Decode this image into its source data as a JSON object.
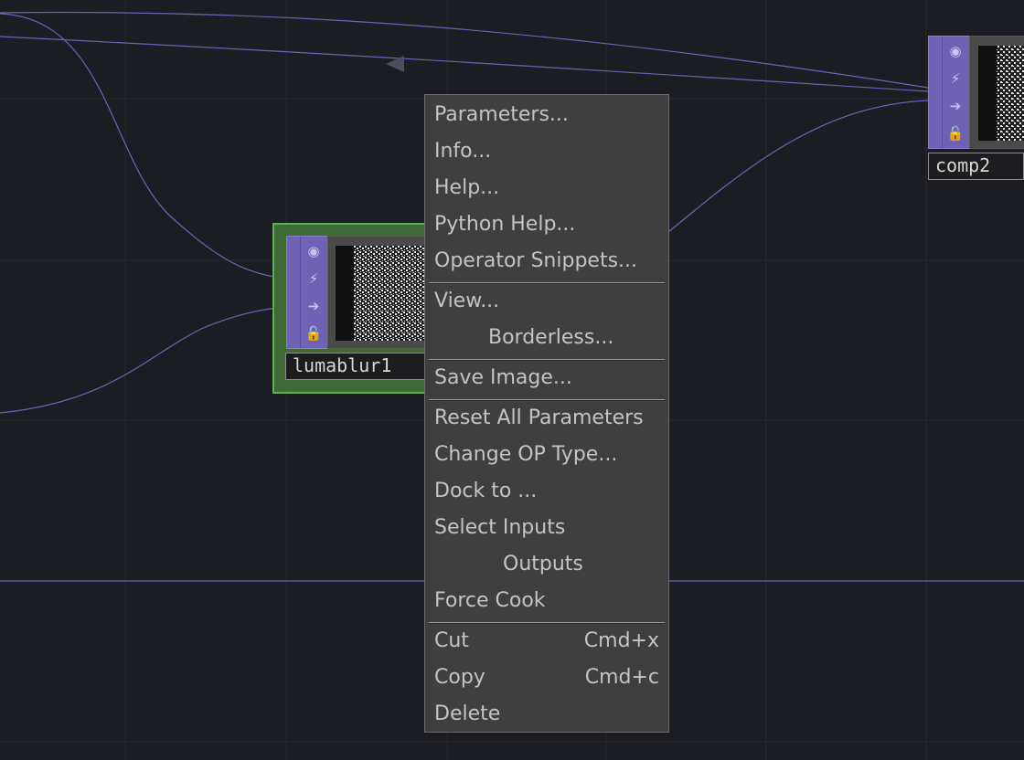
{
  "colors": {
    "background": "#1c1d22",
    "grid": "#272830",
    "wire": "#6c63b8",
    "operator_strip": "#6f62b4",
    "selected_border": "#5fae58",
    "menu_bg": "#3f3f3f",
    "menu_text": "#c4c4c4"
  },
  "nodes": {
    "lumablur": {
      "name": "lumablur1",
      "selected": true
    },
    "comp": {
      "name": "comp2",
      "selected": false
    }
  },
  "node_flags": [
    "viewer-flag-icon",
    "cook-flag-icon",
    "bypass-flag-icon",
    "lock-flag-icon"
  ],
  "menu": {
    "parameters": "Parameters...",
    "info": "Info...",
    "help": "Help...",
    "python_help": "Python Help...",
    "operator_snippets": "Operator Snippets...",
    "view": "View...",
    "borderless": "Borderless...",
    "save_image": "Save Image...",
    "reset_all_parameters": "Reset All Parameters",
    "change_op_type": "Change OP Type...",
    "dock_to": "Dock to ...",
    "select_inputs": "Select Inputs",
    "outputs": "Outputs",
    "force_cook": "Force Cook",
    "cut": "Cut",
    "cut_shortcut": "Cmd+x",
    "copy": "Copy",
    "copy_shortcut": "Cmd+c",
    "delete": "Delete"
  }
}
